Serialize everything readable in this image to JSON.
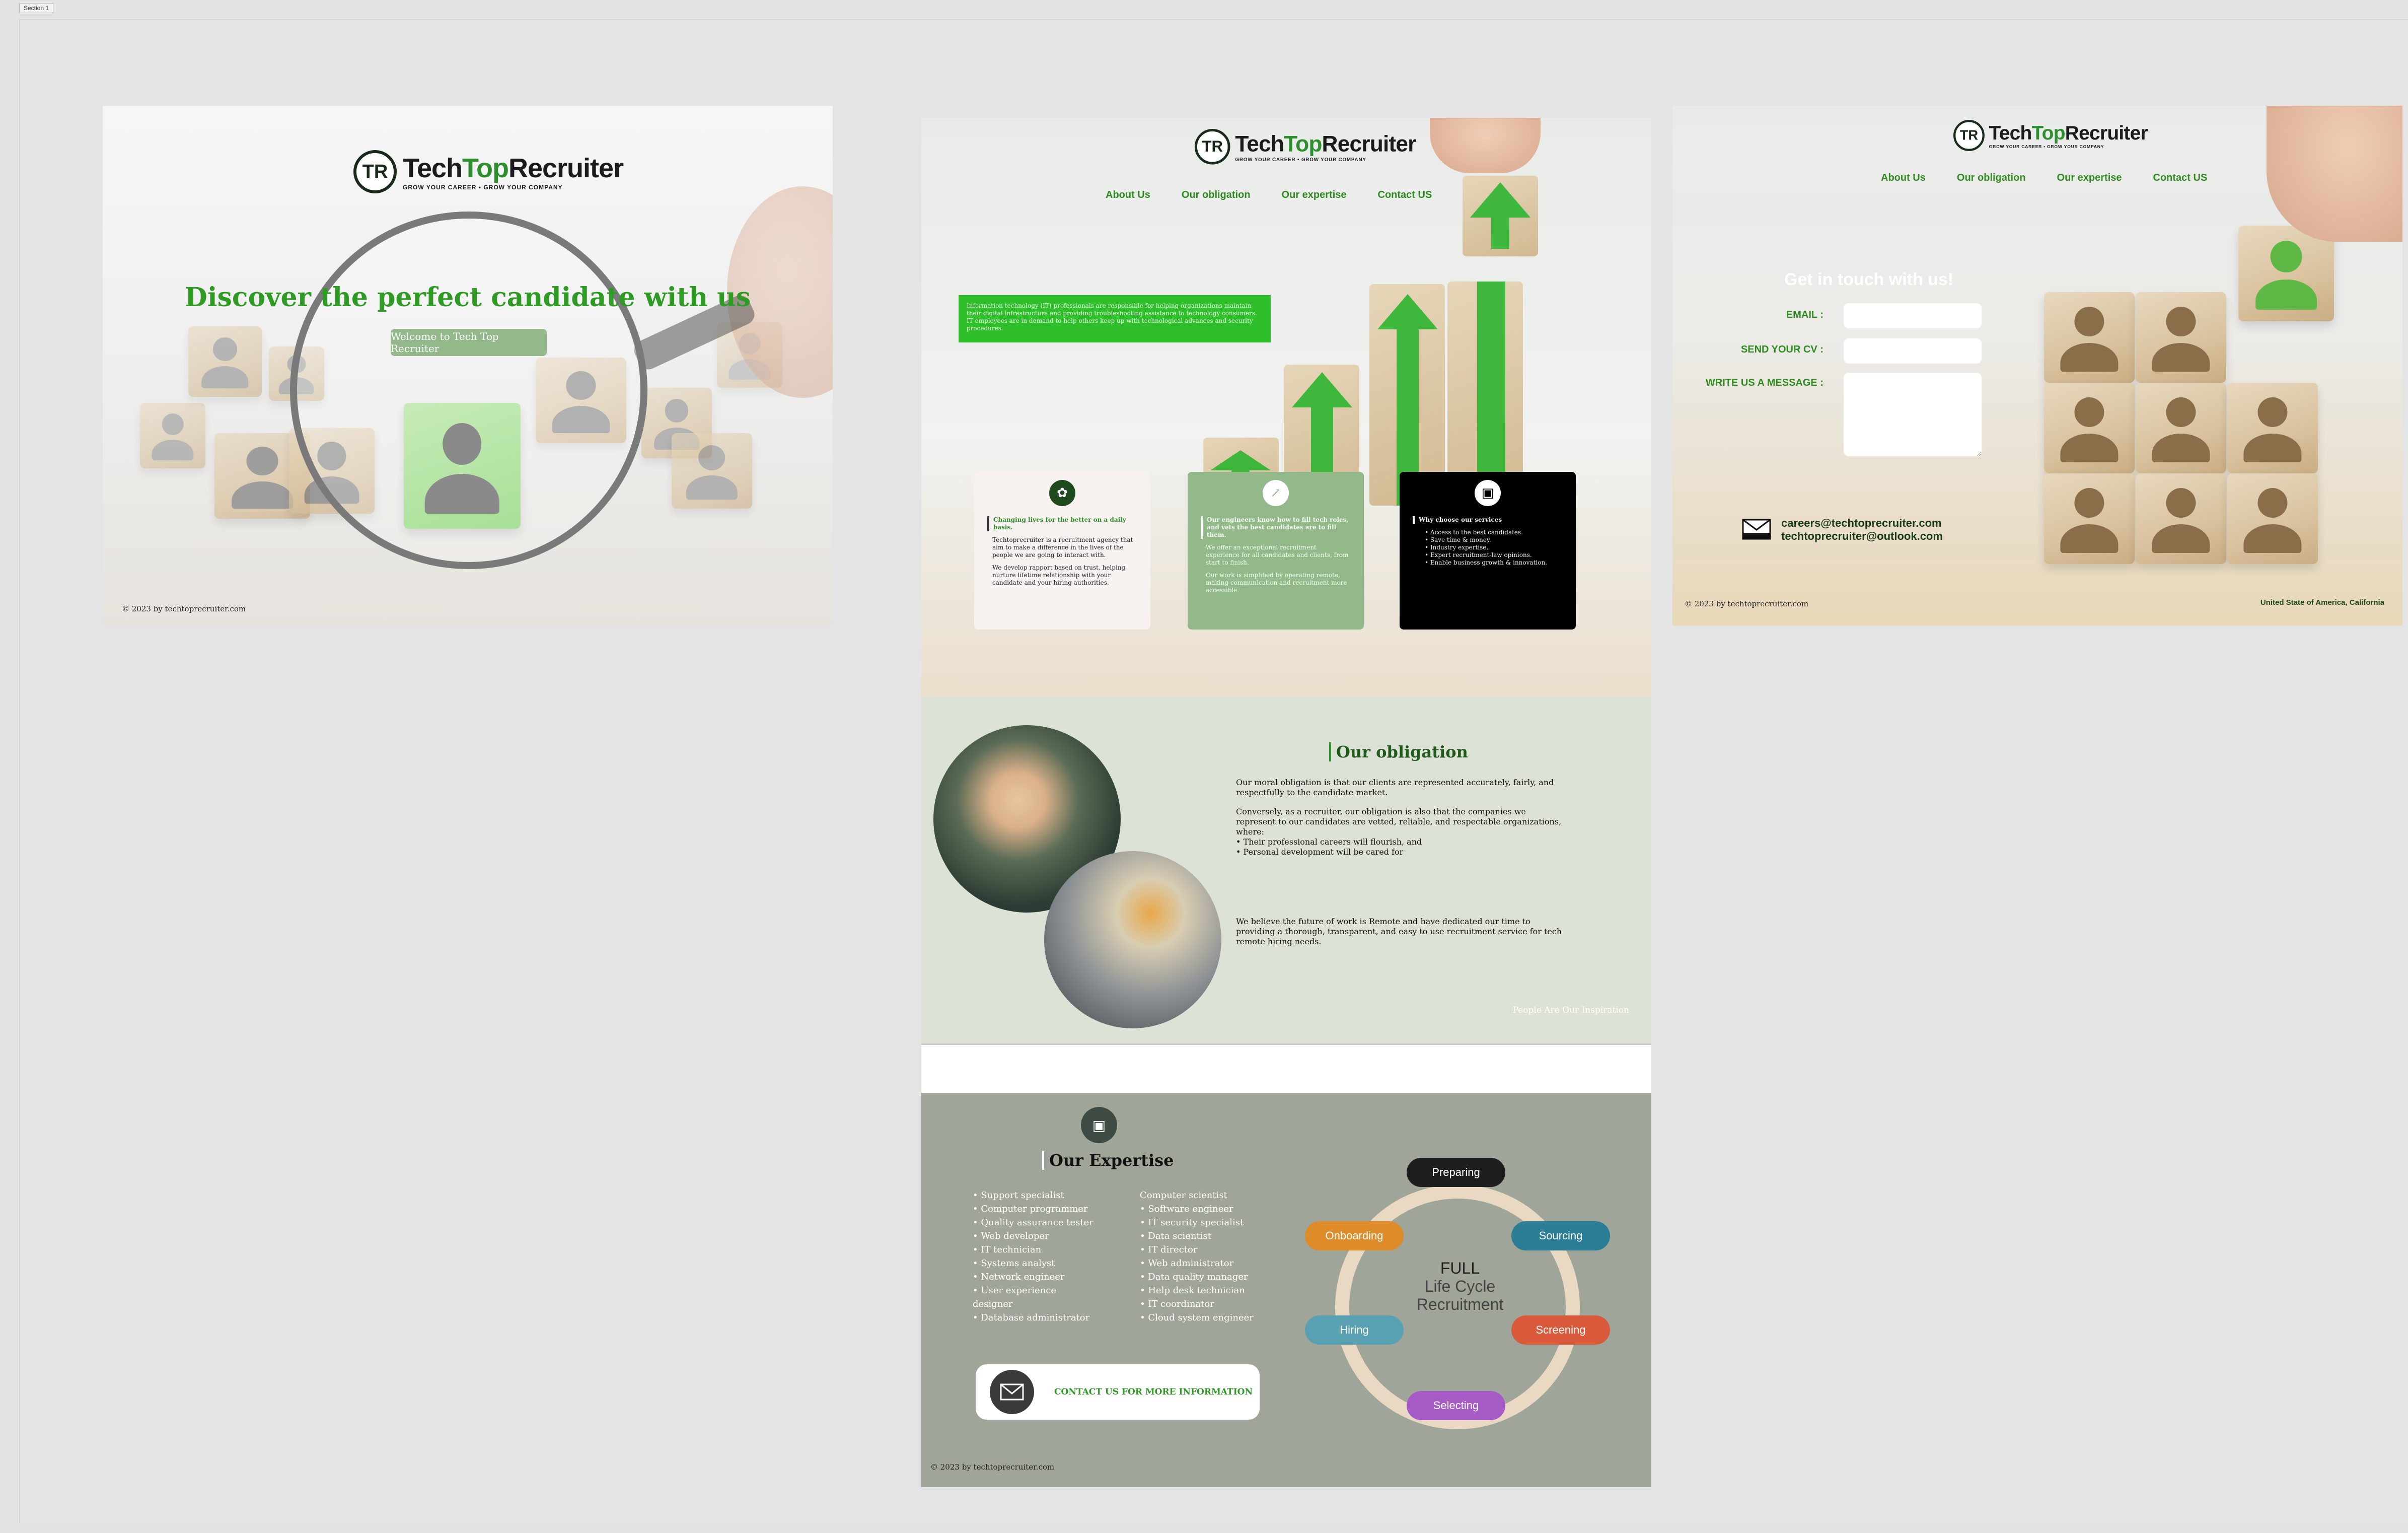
{
  "section_tag": "Section 1",
  "brand": {
    "mark": "TR",
    "name_dark": "Tech",
    "name_green": "Top",
    "name_rest": "Recruiter",
    "tagline": "GROW YOUR CAREER • GROW YOUR COMPANY"
  },
  "nav": [
    "About Us",
    "Our obligation",
    "Our expertise",
    "Contact US"
  ],
  "landing": {
    "title": "Discover the perfect candidate with us",
    "button": "Welcome to Tech Top Recruiter",
    "copyright": "© 2023 by techtoprecruiter.com"
  },
  "home": {
    "info_box": "Information technology (IT) professionals are responsible for helping organizations maintain their digital infrastructure and providing troubleshooting assistance to technology consumers. IT employees are in demand to help others keep up with technological advances and security procedures.",
    "cards": [
      {
        "title": "Changing lives for the better on a daily basis.",
        "paragraphs": [
          "Techtoprecruiter is a recruitment agency that aim to make a difference in the lives of the people we are going to interact with.",
          "We develop rapport based on trust, helping nurture lifetime relationship with your candidate and your hiring authorities."
        ]
      },
      {
        "title": "Our engineers know how to fill tech roles, and vets the best candidates are to fill them.",
        "paragraphs": [
          "We offer an exceptional recruitment experience for all candidates and clients, from start to finish.",
          "Our work is simplified by operating remote, making communication and recruitment more accessible."
        ]
      },
      {
        "title": "Why choose our services",
        "bullets": [
          "Access to the best candidates.",
          "Save time & money.",
          "Industry expertise.",
          "Expert recruitment-law opinions.",
          "Enable business growth & innovation."
        ]
      }
    ]
  },
  "obligation": {
    "title": "Our obligation",
    "p1": "Our moral obligation is that our clients are represented accurately, fairly, and respectfully to the candidate market.",
    "p2": "Conversely, as a recruiter, our obligation is also that the companies we represent to our candidates are vetted, reliable, and respectable organizations, where:",
    "p2_b1": "• Their professional careers will flourish, and",
    "p2_b2": "• Personal development will be cared for",
    "p3": "We believe the future of work is Remote and have dedicated our time to providing a thorough, transparent, and easy to use recruitment service for tech remote hiring needs.",
    "inspiration": "People Are Our Inspiration"
  },
  "expertise": {
    "title": "Our Expertise",
    "col1": [
      "• Support specialist",
      "• Computer programmer",
      "• Quality assurance tester",
      "• Web developer",
      "• IT technician",
      "• Systems analyst",
      "• Network engineer",
      "• User experience",
      "designer",
      "• Database administrator"
    ],
    "col2": [
      "Computer scientist",
      "• Software engineer",
      "• IT security specialist",
      "• Data scientist",
      "• IT director",
      "• Web administrator",
      "• Data quality manager",
      "• Help desk technician",
      "• IT coordinator",
      "• Cloud system engineer"
    ],
    "contact_button": "CONTACT US FOR MORE INFORMATION",
    "lifecycle": {
      "center_line1": "FULL",
      "center_line2": "Life Cycle",
      "center_line3": "Recruitment",
      "steps": [
        "Preparing",
        "Sourcing",
        "Screening",
        "Selecting",
        "Hiring",
        "Onboarding"
      ]
    },
    "copyright": "© 2023 by techtoprecruiter.com"
  },
  "contact": {
    "heading": "Get in touch with us!",
    "email_label": "EMAIL :",
    "cv_label": "SEND YOUR CV :",
    "message_label": "WRITE US A MESSAGE :",
    "email_1": "careers@techtoprecruiter.com",
    "email_2": "techtoprecruiter@outlook.com",
    "copyright": "© 2023 by techtoprecruiter.com",
    "location": "United State of America, California"
  },
  "colors": {
    "brand_green": "#2f9a24",
    "bright_green": "#3fb63c",
    "sage": "#93b88a",
    "dark_card": "#000000",
    "expertise_bg": "#a0a59a",
    "preparing": "#1e1e1e",
    "sourcing": "#2a7d94",
    "screening": "#d85a3a",
    "selecting": "#a75bc7",
    "hiring": "#5aa0b3",
    "onboarding": "#de8b2a"
  }
}
